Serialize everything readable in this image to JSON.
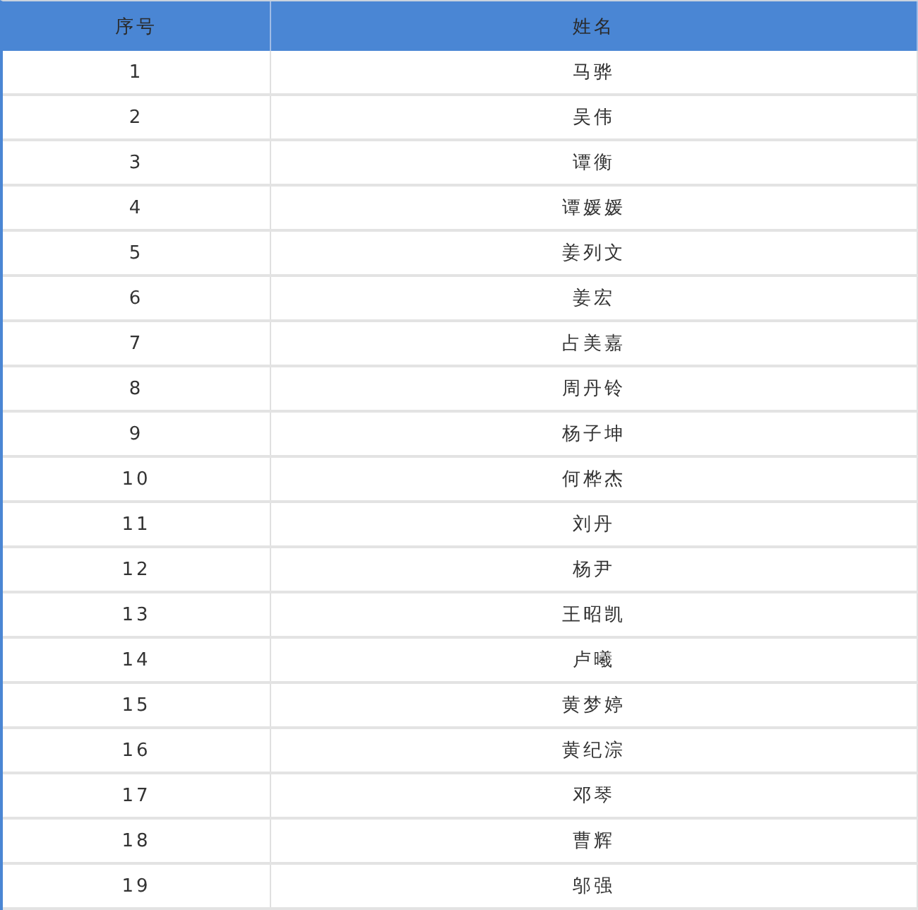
{
  "table": {
    "columns": [
      "序号",
      "姓名"
    ],
    "rows": [
      [
        "1",
        "马骅"
      ],
      [
        "2",
        "吴伟"
      ],
      [
        "3",
        "谭衡"
      ],
      [
        "4",
        "谭媛媛"
      ],
      [
        "5",
        "姜列文"
      ],
      [
        "6",
        "姜宏"
      ],
      [
        "7",
        "占美嘉"
      ],
      [
        "8",
        "周丹铃"
      ],
      [
        "9",
        "杨子坤"
      ],
      [
        "10",
        "何桦杰"
      ],
      [
        "11",
        "刘丹"
      ],
      [
        "12",
        "杨尹"
      ],
      [
        "13",
        "王昭凯"
      ],
      [
        "14",
        "卢曦"
      ],
      [
        "15",
        "黄梦婷"
      ],
      [
        "16",
        "黄纪淙"
      ],
      [
        "17",
        "邓琴"
      ],
      [
        "18",
        "曹辉"
      ],
      [
        "19",
        "邬强"
      ]
    ]
  }
}
